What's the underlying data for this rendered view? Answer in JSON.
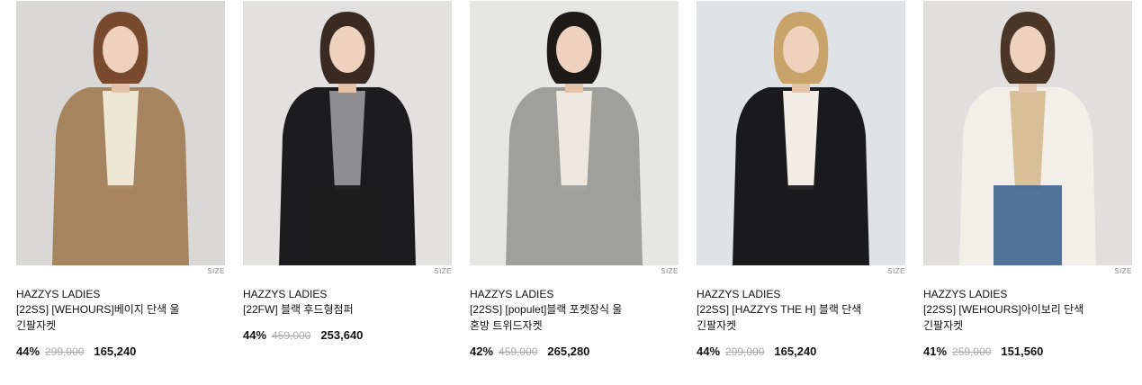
{
  "products": [
    {
      "brand": "HAZZYS LADIES",
      "name_line1": "[22SS] [WEHOURS]베이지 단색 울",
      "name_line2": "긴팔자켓",
      "discount": "44%",
      "original_price": "299,000",
      "sale_price": "165,240",
      "size_label": "SIZE",
      "image": {
        "bg": "#d9d8d6",
        "outfit": "#a6845f",
        "inner": "#efe7d6",
        "hair": "#7a4a2e"
      }
    },
    {
      "brand": "HAZZYS LADIES",
      "name_line1": "[22FW] 블랙 후드형점퍼",
      "name_line2": "",
      "discount": "44%",
      "original_price": "459,000",
      "sale_price": "253,640",
      "size_label": "SIZE",
      "image": {
        "bg": "#e2e1df",
        "outfit": "#1c1c1e",
        "inner": "#8e8e90",
        "hair": "#3a2a22"
      }
    },
    {
      "brand": "HAZZYS LADIES",
      "name_line1": "[22SS] [populet]블랙 포켓장식 울",
      "name_line2": "혼방 트위드자켓",
      "discount": "42%",
      "original_price": "459,000",
      "sale_price": "265,280",
      "size_label": "SIZE",
      "image": {
        "bg": "#e6e6e4",
        "outfit": "#9fa09c",
        "inner": "#ece8e0",
        "hair": "#1e1a18"
      }
    },
    {
      "brand": "HAZZYS LADIES",
      "name_line1": "[22SS] [HAZZYS THE H] 블랙 단색",
      "name_line2": "긴팔자켓",
      "discount": "44%",
      "original_price": "299,000",
      "sale_price": "165,240",
      "size_label": "SIZE",
      "image": {
        "bg": "#dfe3e6",
        "outfit": "#1a1a1c",
        "inner": "#f2ede6",
        "hair": "#c9a46a"
      }
    },
    {
      "brand": "HAZZYS LADIES",
      "name_line1": "[22SS] [WEHOURS]아이보리 단색",
      "name_line2": "긴팔자켓",
      "discount": "41%",
      "original_price": "259,000",
      "sale_price": "151,560",
      "size_label": "SIZE",
      "image": {
        "bg": "#e0dfdd",
        "outfit": "#f1efe8",
        "inner": "#d9bf98",
        "hair": "#4a3526",
        "pants": "#4a6a93"
      }
    }
  ]
}
